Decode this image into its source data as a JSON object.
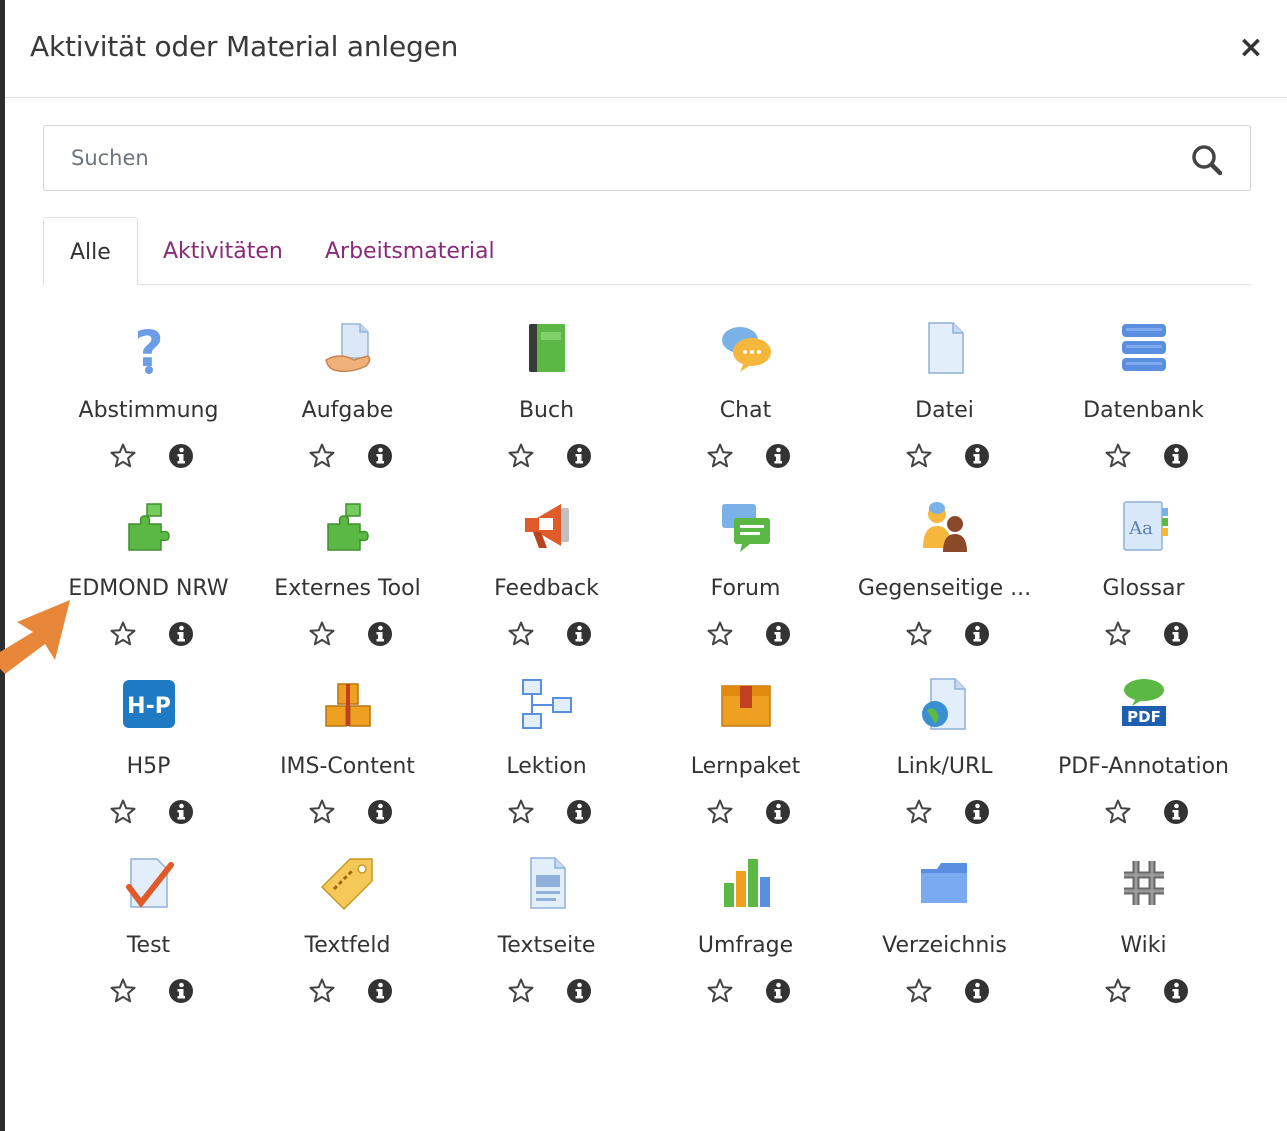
{
  "modal": {
    "title": "Aktivität oder Material anlegen",
    "close_symbol": "×"
  },
  "search": {
    "placeholder": "Suchen"
  },
  "tabs": [
    {
      "label": "Alle",
      "active": true
    },
    {
      "label": "Aktivitäten",
      "active": false
    },
    {
      "label": "Arbeitsmaterial",
      "active": false
    }
  ],
  "items": [
    {
      "label": "Abstimmung",
      "icon": "question-mark-icon"
    },
    {
      "label": "Aufgabe",
      "icon": "assignment-hand-icon"
    },
    {
      "label": "Buch",
      "icon": "book-icon"
    },
    {
      "label": "Chat",
      "icon": "chat-bubble-icon"
    },
    {
      "label": "Datei",
      "icon": "file-icon"
    },
    {
      "label": "Datenbank",
      "icon": "database-icon"
    },
    {
      "label": "EDMOND NRW",
      "icon": "puzzle-icon"
    },
    {
      "label": "Externes Tool",
      "icon": "puzzle-icon"
    },
    {
      "label": "Feedback",
      "icon": "megaphone-icon"
    },
    {
      "label": "Forum",
      "icon": "forum-icon"
    },
    {
      "label": "Gegenseitige ...",
      "icon": "workshop-people-icon"
    },
    {
      "label": "Glossar",
      "icon": "glossary-icon"
    },
    {
      "label": "H5P",
      "icon": "h5p-icon"
    },
    {
      "label": "IMS-Content",
      "icon": "ims-boxes-icon"
    },
    {
      "label": "Lektion",
      "icon": "lesson-flow-icon"
    },
    {
      "label": "Lernpaket",
      "icon": "scorm-package-icon"
    },
    {
      "label": "Link/URL",
      "icon": "url-globe-icon"
    },
    {
      "label": "PDF-Annotation",
      "icon": "pdf-annotation-icon"
    },
    {
      "label": "Test",
      "icon": "quiz-check-icon"
    },
    {
      "label": "Textfeld",
      "icon": "label-tag-icon"
    },
    {
      "label": "Textseite",
      "icon": "page-icon"
    },
    {
      "label": "Umfrage",
      "icon": "survey-chart-icon"
    },
    {
      "label": "Verzeichnis",
      "icon": "folder-icon"
    },
    {
      "label": "Wiki",
      "icon": "wiki-icon"
    }
  ],
  "colors": {
    "tab_link": "#8a2a78",
    "arrow": "#e8873a"
  }
}
